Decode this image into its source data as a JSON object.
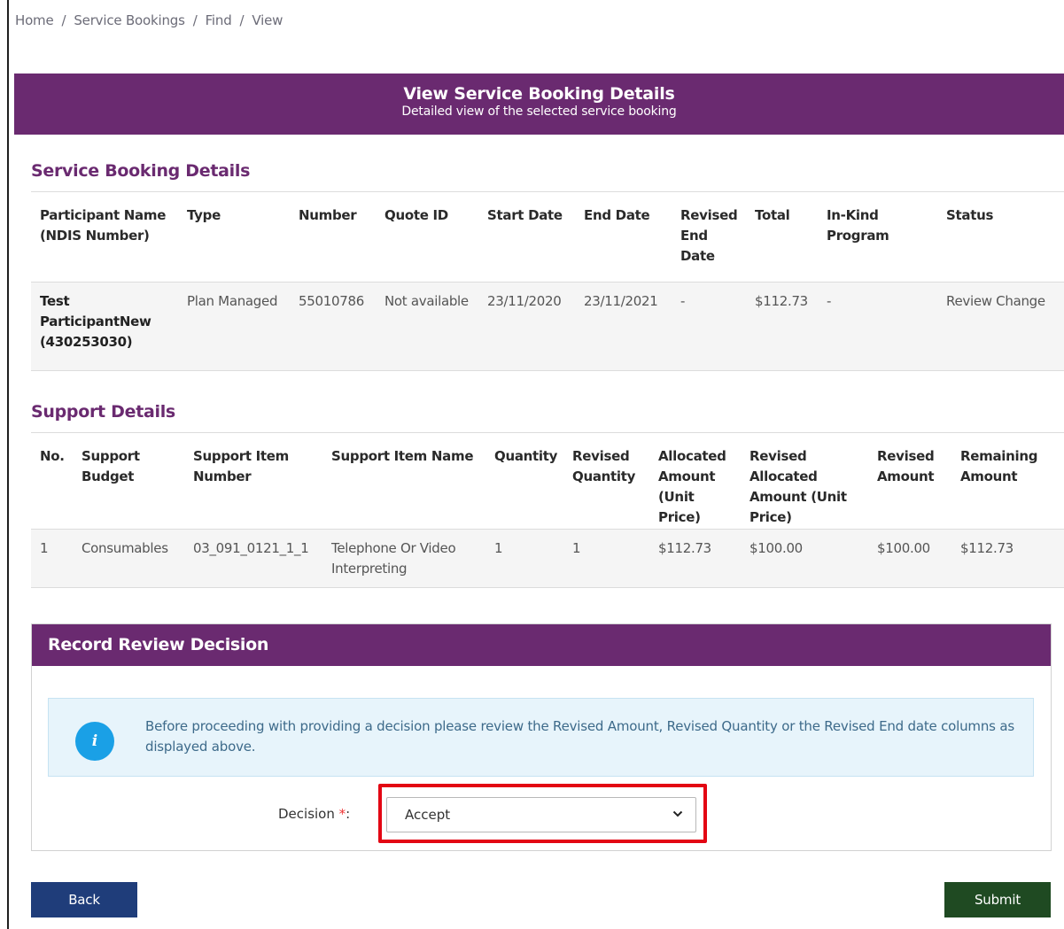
{
  "breadcrumb": [
    "Home",
    "Service Bookings",
    "Find",
    "View"
  ],
  "banner": {
    "title": "View Service Booking Details",
    "subtitle": "Detailed view of the selected service booking"
  },
  "service_booking": {
    "section_title": "Service Booking Details",
    "headers": [
      "Participant Name (NDIS Number)",
      "Type",
      "Number",
      "Quote ID",
      "Start Date",
      "End Date",
      "Revised End Date",
      "Total",
      "In-Kind Program",
      "Status"
    ],
    "row": {
      "participant": "Test ParticipantNew (430253030)",
      "type": "Plan Managed",
      "number": "55010786",
      "quote_id": "Not available",
      "start_date": "23/11/2020",
      "end_date": "23/11/2021",
      "revised_end_date": "-",
      "total": "$112.73",
      "in_kind": "-",
      "status": "Review Change"
    }
  },
  "support": {
    "section_title": "Support Details",
    "headers": [
      "No.",
      "Support Budget",
      "Support Item Number",
      "Support Item Name",
      "Quantity",
      "Revised Quantity",
      "Allocated Amount (Unit Price)",
      "Revised Allocated Amount (Unit Price)",
      "Revised Amount",
      "Remaining Amount"
    ],
    "row": {
      "no": "1",
      "budget": "Consumables",
      "item_number": "03_091_0121_1_1",
      "item_name": "Telephone Or Video Interpreting",
      "quantity": "1",
      "revised_quantity": "1",
      "allocated": "$112.73",
      "revised_allocated": "$100.00",
      "revised_amount": "$100.00",
      "remaining": "$112.73"
    }
  },
  "decision": {
    "title": "Record Review Decision",
    "info_icon": "info-icon",
    "info_text": "Before proceeding with providing a decision please review the Revised Amount, Revised Quantity or the Revised End date columns as displayed above.",
    "label": "Decision",
    "required_mark": "*",
    "label_suffix": ":",
    "selected": "Accept"
  },
  "buttons": {
    "back": "Back",
    "submit": "Submit"
  },
  "colors": {
    "brand_purple": "#6a2a70",
    "info_blue": "#1aa0e6",
    "highlight_red": "#e30613",
    "back_button": "#1f3d7a",
    "submit_button": "#1f4a22"
  }
}
